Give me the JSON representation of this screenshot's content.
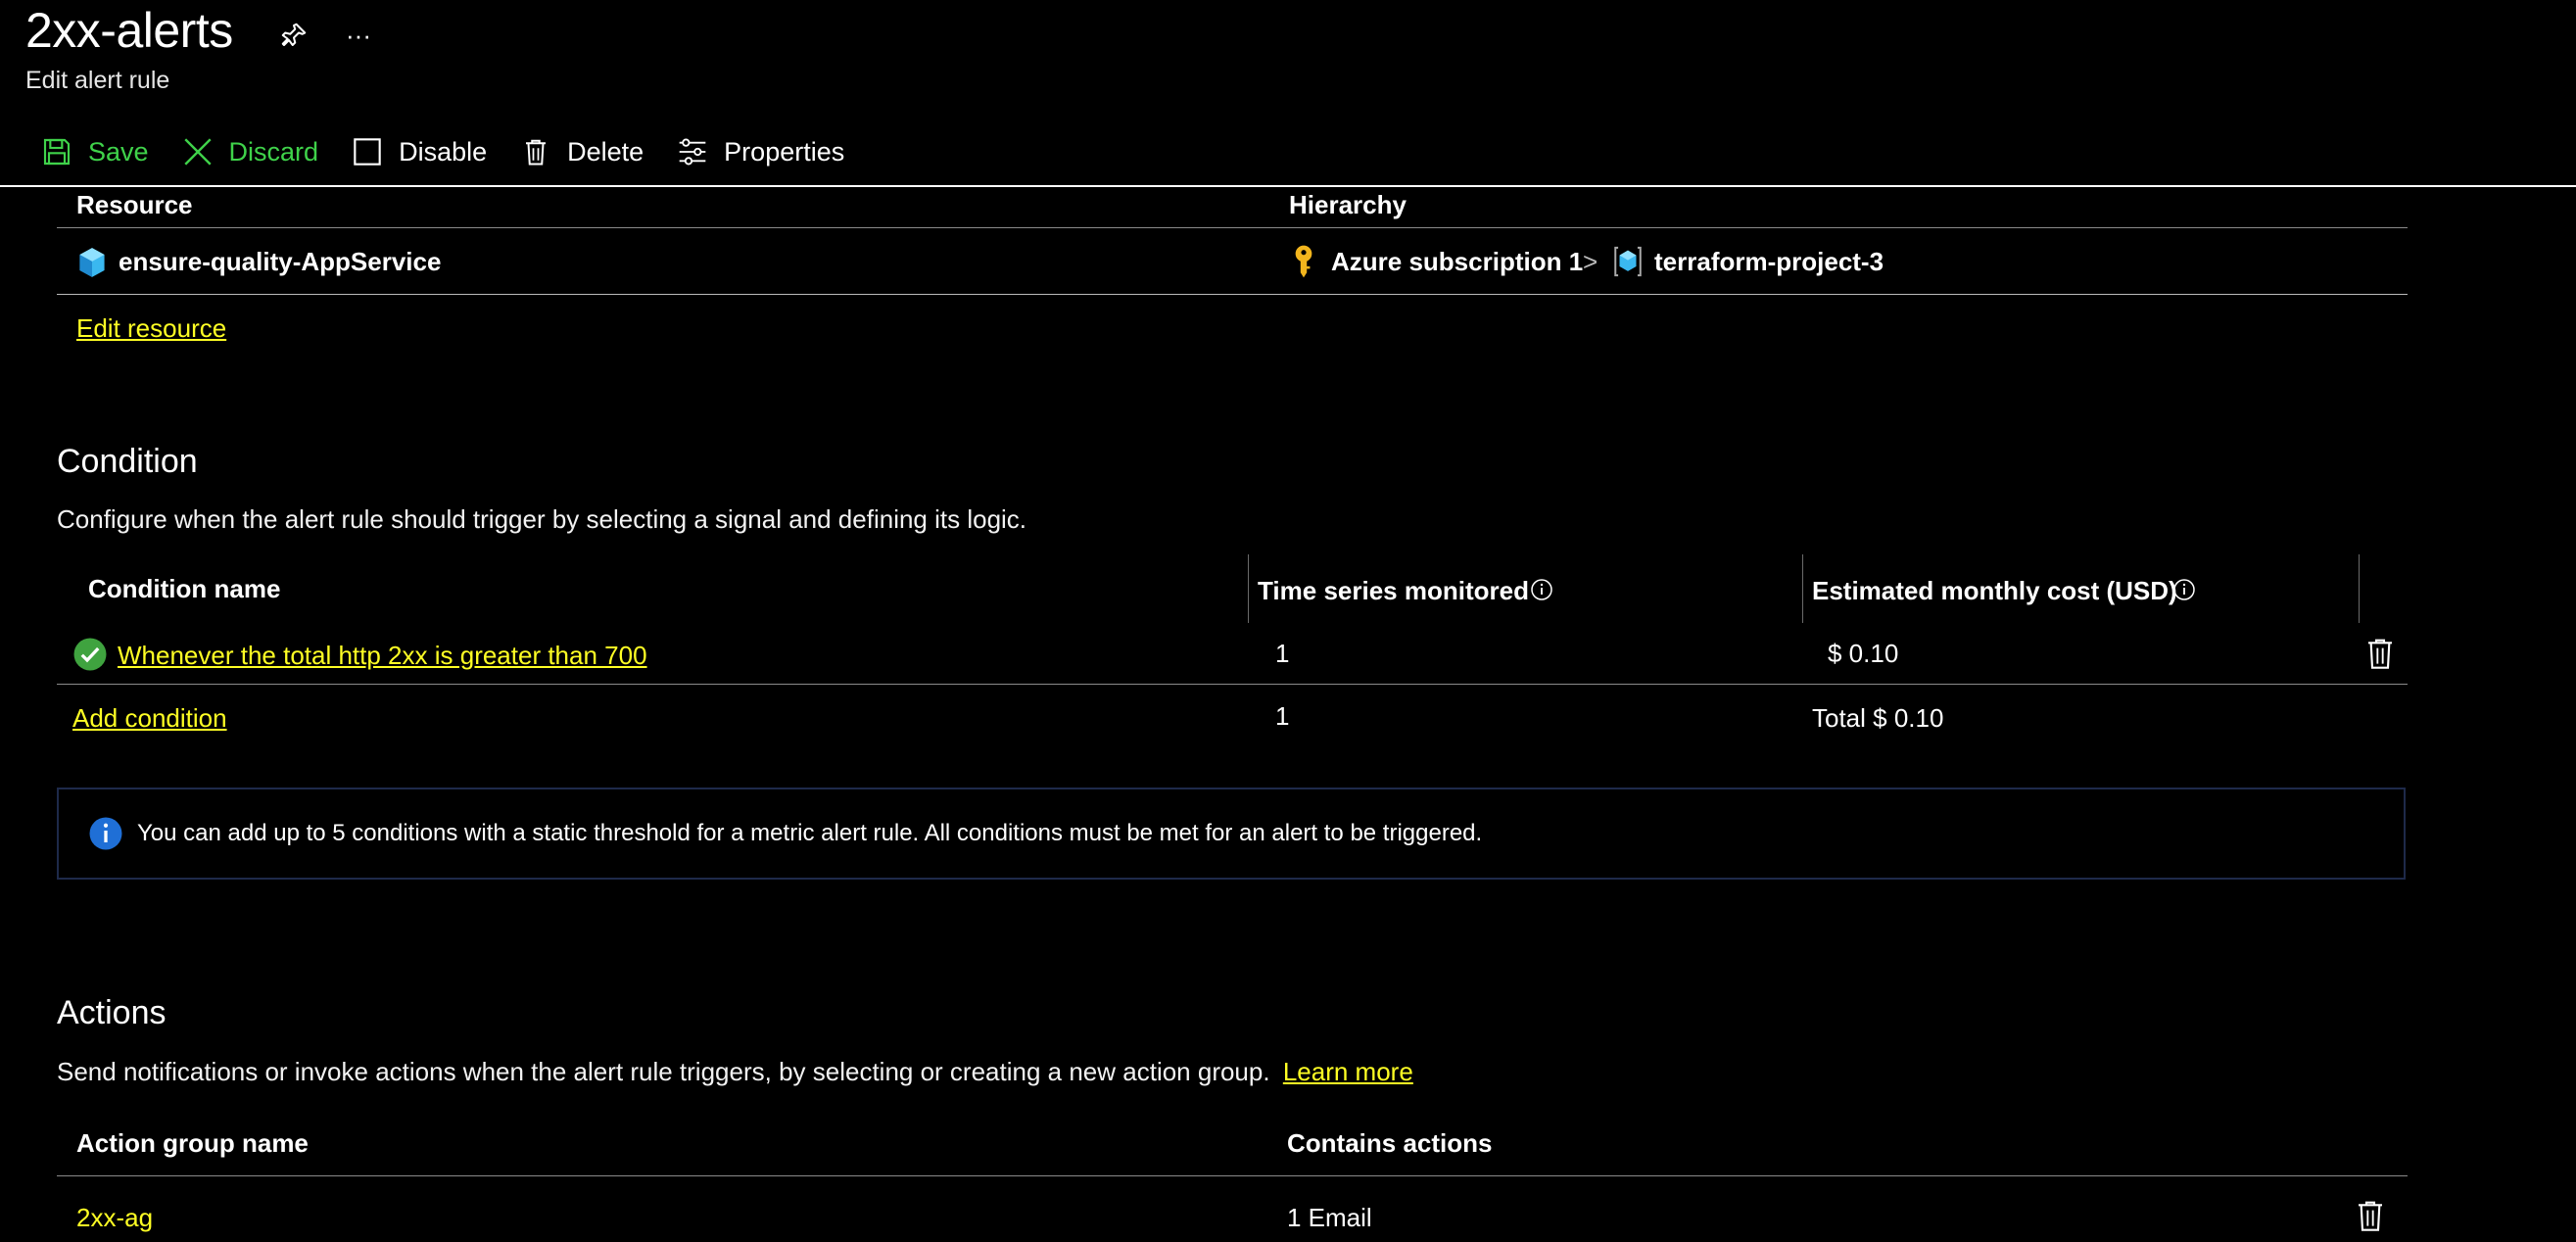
{
  "header": {
    "title": "2xx-alerts",
    "subtitle": "Edit alert rule",
    "pin_icon": "pin-icon",
    "more_icon": "ellipsis-icon",
    "more_glyph": "···"
  },
  "toolbar": {
    "save_label": "Save",
    "discard_label": "Discard",
    "disable_label": "Disable",
    "delete_label": "Delete",
    "properties_label": "Properties",
    "accent_color": "#3fd24a"
  },
  "scope": {
    "columns": [
      "Resource",
      "Hierarchy"
    ],
    "resource_name": "ensure-quality-AppService",
    "hierarchy": [
      "Azure subscription 1",
      "terraform-project-3"
    ],
    "separator": ">",
    "edit_resource_label": "Edit resource"
  },
  "condition": {
    "heading": "Condition",
    "description": "Configure when the alert rule should trigger by selecting a signal and defining its logic.",
    "columns": {
      "name": "Condition name",
      "time_series": "Time series monitored",
      "cost": "Estimated monthly cost (USD)"
    },
    "rows": [
      {
        "name": "Whenever the total http 2xx is greater than 700",
        "time_series": "1",
        "cost": "$ 0.10"
      }
    ],
    "add_condition_label": "Add condition",
    "total_time_series": "1",
    "total_cost": "Total $ 0.10",
    "info_text": "You can add up to 5 conditions with a static threshold for a metric alert rule. All conditions must be met for an alert to be triggered."
  },
  "actions": {
    "heading": "Actions",
    "description": "Send notifications or invoke actions when the alert rule triggers, by selecting or creating a new action group.",
    "learn_more": "Learn more",
    "columns": {
      "name": "Action group name",
      "contains": "Contains actions"
    },
    "rows": [
      {
        "name": "2xx-ag",
        "contains": "1 Email"
      }
    ]
  },
  "colors": {
    "background": "#000000",
    "link": "#ffff24",
    "success": "#3fa33f",
    "info": "#1f6fd6",
    "key": "#f2b51d",
    "resource": "#3ab8f0"
  }
}
